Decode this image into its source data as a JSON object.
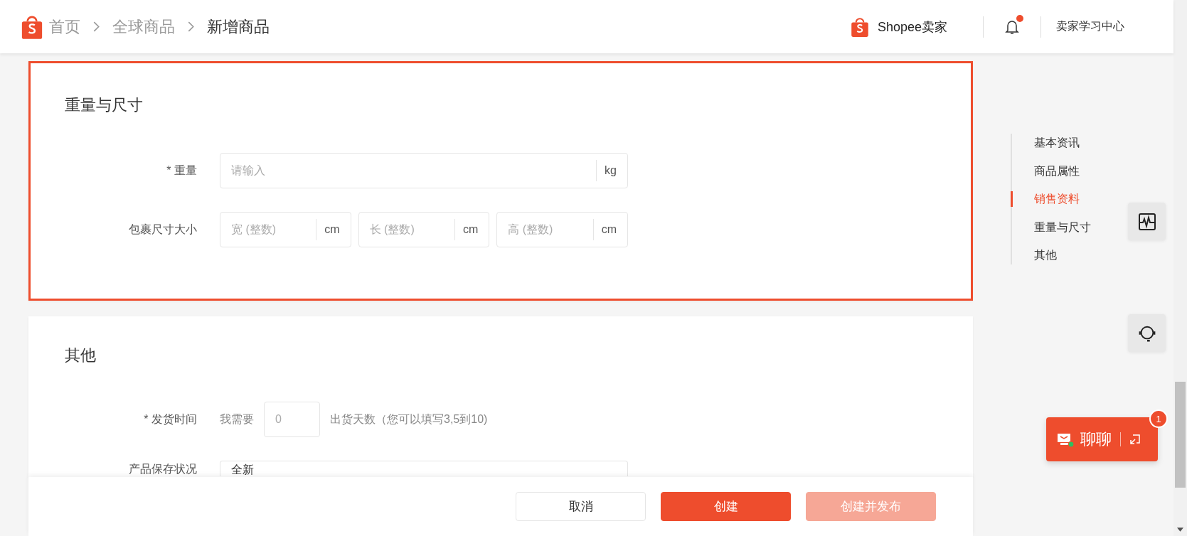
{
  "header": {
    "breadcrumbs": [
      {
        "label": "首页",
        "current": false
      },
      {
        "label": "全球商品",
        "current": false
      },
      {
        "label": "新增商品",
        "current": true
      }
    ],
    "brand": "Shopee卖家",
    "notification_unread": true,
    "learning_center": "卖家学习中心"
  },
  "sections": [
    {
      "title": "重量与尺寸",
      "highlighted": true,
      "fields": [
        {
          "kind": "input",
          "required_mark": "*",
          "label": "重量",
          "placeholder": "请输入",
          "unit": "kg"
        },
        {
          "kind": "dimensions",
          "label": "包裹尺寸大小",
          "inputs": [
            {
              "placeholder": "宽 (整数)",
              "unit": "cm"
            },
            {
              "placeholder": "长 (整数)",
              "unit": "cm"
            },
            {
              "placeholder": "高 (整数)",
              "unit": "cm"
            }
          ]
        }
      ]
    },
    {
      "title": "其他",
      "highlighted": false,
      "fields": [
        {
          "kind": "days",
          "required_mark": "*",
          "label": "发货时间",
          "prefix": "我需要",
          "placeholder": "0",
          "suffix": "出货天数（您可以填写3,5到10)"
        },
        {
          "kind": "select",
          "label": "产品保存状况",
          "value": "全新"
        }
      ]
    }
  ],
  "footer": {
    "buttons": [
      {
        "label": "取消",
        "kind": "secondary"
      },
      {
        "label": "创建",
        "kind": "primary"
      },
      {
        "label": "创建并发布",
        "kind": "disabled"
      }
    ]
  },
  "anchor_nav": {
    "items": [
      {
        "label": "基本资讯",
        "selected": false
      },
      {
        "label": "商品属性",
        "selected": false
      },
      {
        "label": "销售资料",
        "selected": true
      },
      {
        "label": "重量与尺寸",
        "selected": false
      },
      {
        "label": "其他",
        "selected": false
      }
    ]
  },
  "chat": {
    "label": "聊聊",
    "badge": "1"
  }
}
